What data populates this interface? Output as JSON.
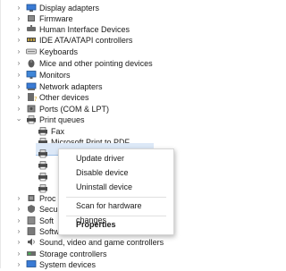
{
  "tree": {
    "categories": [
      {
        "label": "Display adapters",
        "icon": "display-adapter-icon"
      },
      {
        "label": "Firmware",
        "icon": "firmware-icon"
      },
      {
        "label": "Human Interface Devices",
        "icon": "hid-icon"
      },
      {
        "label": "IDE ATA/ATAPI controllers",
        "icon": "ide-controller-icon"
      },
      {
        "label": "Keyboards",
        "icon": "keyboard-icon"
      },
      {
        "label": "Mice and other pointing devices",
        "icon": "mouse-icon"
      },
      {
        "label": "Monitors",
        "icon": "monitor-icon"
      },
      {
        "label": "Network adapters",
        "icon": "network-adapter-icon"
      },
      {
        "label": "Other devices",
        "icon": "other-devices-icon"
      },
      {
        "label": "Ports (COM & LPT)",
        "icon": "ports-icon"
      },
      {
        "label": "Print queues",
        "icon": "printer-icon",
        "expanded": true
      }
    ],
    "print_queue_children": [
      {
        "label": "Fax",
        "icon": "printer-icon"
      },
      {
        "label": "Microsoft Print to PDF",
        "icon": "printer-icon"
      },
      {
        "label": "",
        "icon": "printer-icon",
        "selected": true
      },
      {
        "label": "",
        "icon": "printer-icon"
      },
      {
        "label": "",
        "icon": "printer-icon"
      },
      {
        "label": "",
        "icon": "printer-icon"
      }
    ],
    "partial_categories": [
      {
        "label": "Proc",
        "icon": "processor-icon"
      },
      {
        "label": "Secu",
        "icon": "security-icon"
      },
      {
        "label": "Soft",
        "icon": "software-icon"
      }
    ],
    "bottom_categories": [
      {
        "label": "Software devices",
        "icon": "software-devices-icon"
      },
      {
        "label": "Sound, video and game controllers",
        "icon": "sound-icon"
      },
      {
        "label": "Storage controllers",
        "icon": "storage-icon"
      },
      {
        "label": "System devices",
        "icon": "system-devices-icon"
      }
    ]
  },
  "context_menu": {
    "items": [
      {
        "label": "Update driver",
        "bold": false
      },
      {
        "label": "Disable device",
        "bold": false
      },
      {
        "label": "Uninstall device",
        "bold": false
      },
      {
        "label": "Scan for hardware changes",
        "bold": false
      },
      {
        "label": "Properties",
        "bold": true
      }
    ]
  },
  "colors": {
    "selection": "#dce8f7",
    "text": "#1a1a1a",
    "chevron": "#6b6b6b"
  }
}
